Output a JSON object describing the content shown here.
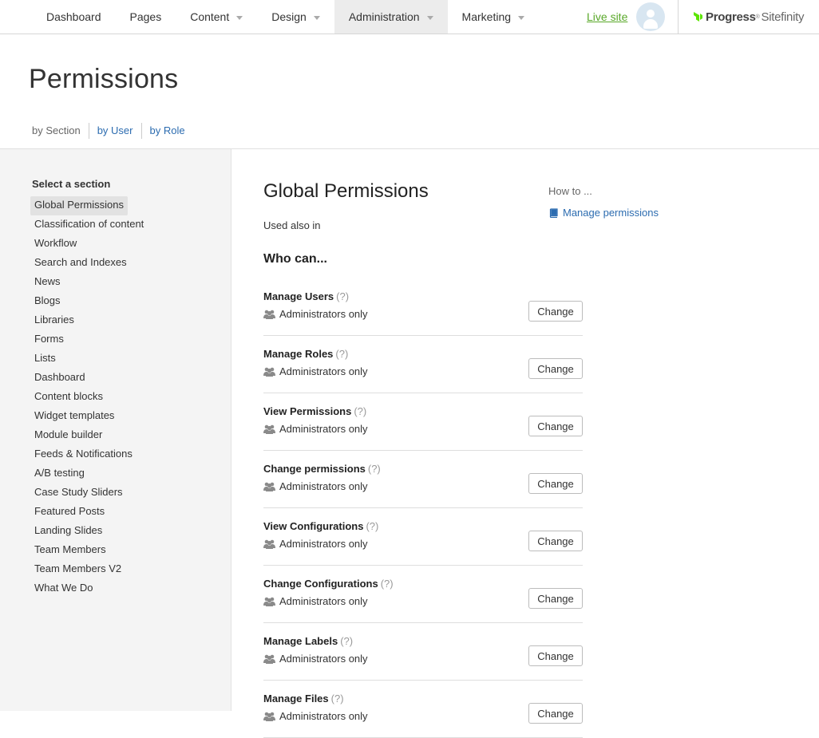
{
  "topnav": {
    "items": [
      {
        "label": "Dashboard",
        "dropdown": false,
        "active": false
      },
      {
        "label": "Pages",
        "dropdown": false,
        "active": false
      },
      {
        "label": "Content",
        "dropdown": true,
        "active": false
      },
      {
        "label": "Design",
        "dropdown": true,
        "active": false
      },
      {
        "label": "Administration",
        "dropdown": true,
        "active": true
      },
      {
        "label": "Marketing",
        "dropdown": true,
        "active": false
      }
    ],
    "live_site": "Live site"
  },
  "brand": {
    "progress": "Progress",
    "sitefinity": "Sitefinity",
    "color": "#5ce500"
  },
  "page": {
    "title": "Permissions",
    "subnav": [
      {
        "label": "by Section",
        "current": true
      },
      {
        "label": "by User",
        "current": false
      },
      {
        "label": "by Role",
        "current": false
      }
    ]
  },
  "sidebar": {
    "title": "Select a section",
    "items": [
      "Global Permissions",
      "Classification of content",
      "Workflow",
      "Search and Indexes",
      "News",
      "Blogs",
      "Libraries",
      "Forms",
      "Lists",
      "Dashboard",
      "Content blocks",
      "Widget templates",
      "Module builder",
      "Feeds & Notifications",
      "A/B testing",
      "Case Study Sliders",
      "Featured Posts",
      "Landing Slides",
      "Team Members",
      "Team Members V2",
      "What We Do"
    ],
    "selected_index": 0
  },
  "main": {
    "title": "Global Permissions",
    "used_also": "Used also in",
    "who_can": "Who can...",
    "howto": {
      "label": "How to ...",
      "link": "Manage permissions"
    },
    "help_label": "(?)",
    "change_label": "Change",
    "permissions": [
      {
        "name": "Manage Users",
        "who": "Administrators only"
      },
      {
        "name": "Manage Roles",
        "who": "Administrators only"
      },
      {
        "name": "View Permissions",
        "who": "Administrators only"
      },
      {
        "name": "Change permissions",
        "who": "Administrators only"
      },
      {
        "name": "View Configurations",
        "who": "Administrators only"
      },
      {
        "name": "Change Configurations",
        "who": "Administrators only"
      },
      {
        "name": "Manage Labels",
        "who": "Administrators only"
      },
      {
        "name": "Manage Files",
        "who": "Administrators only"
      }
    ]
  },
  "colors": {
    "link": "#2c6cb0",
    "live_site": "#59a829",
    "icon_gray": "#8a8a8a"
  }
}
